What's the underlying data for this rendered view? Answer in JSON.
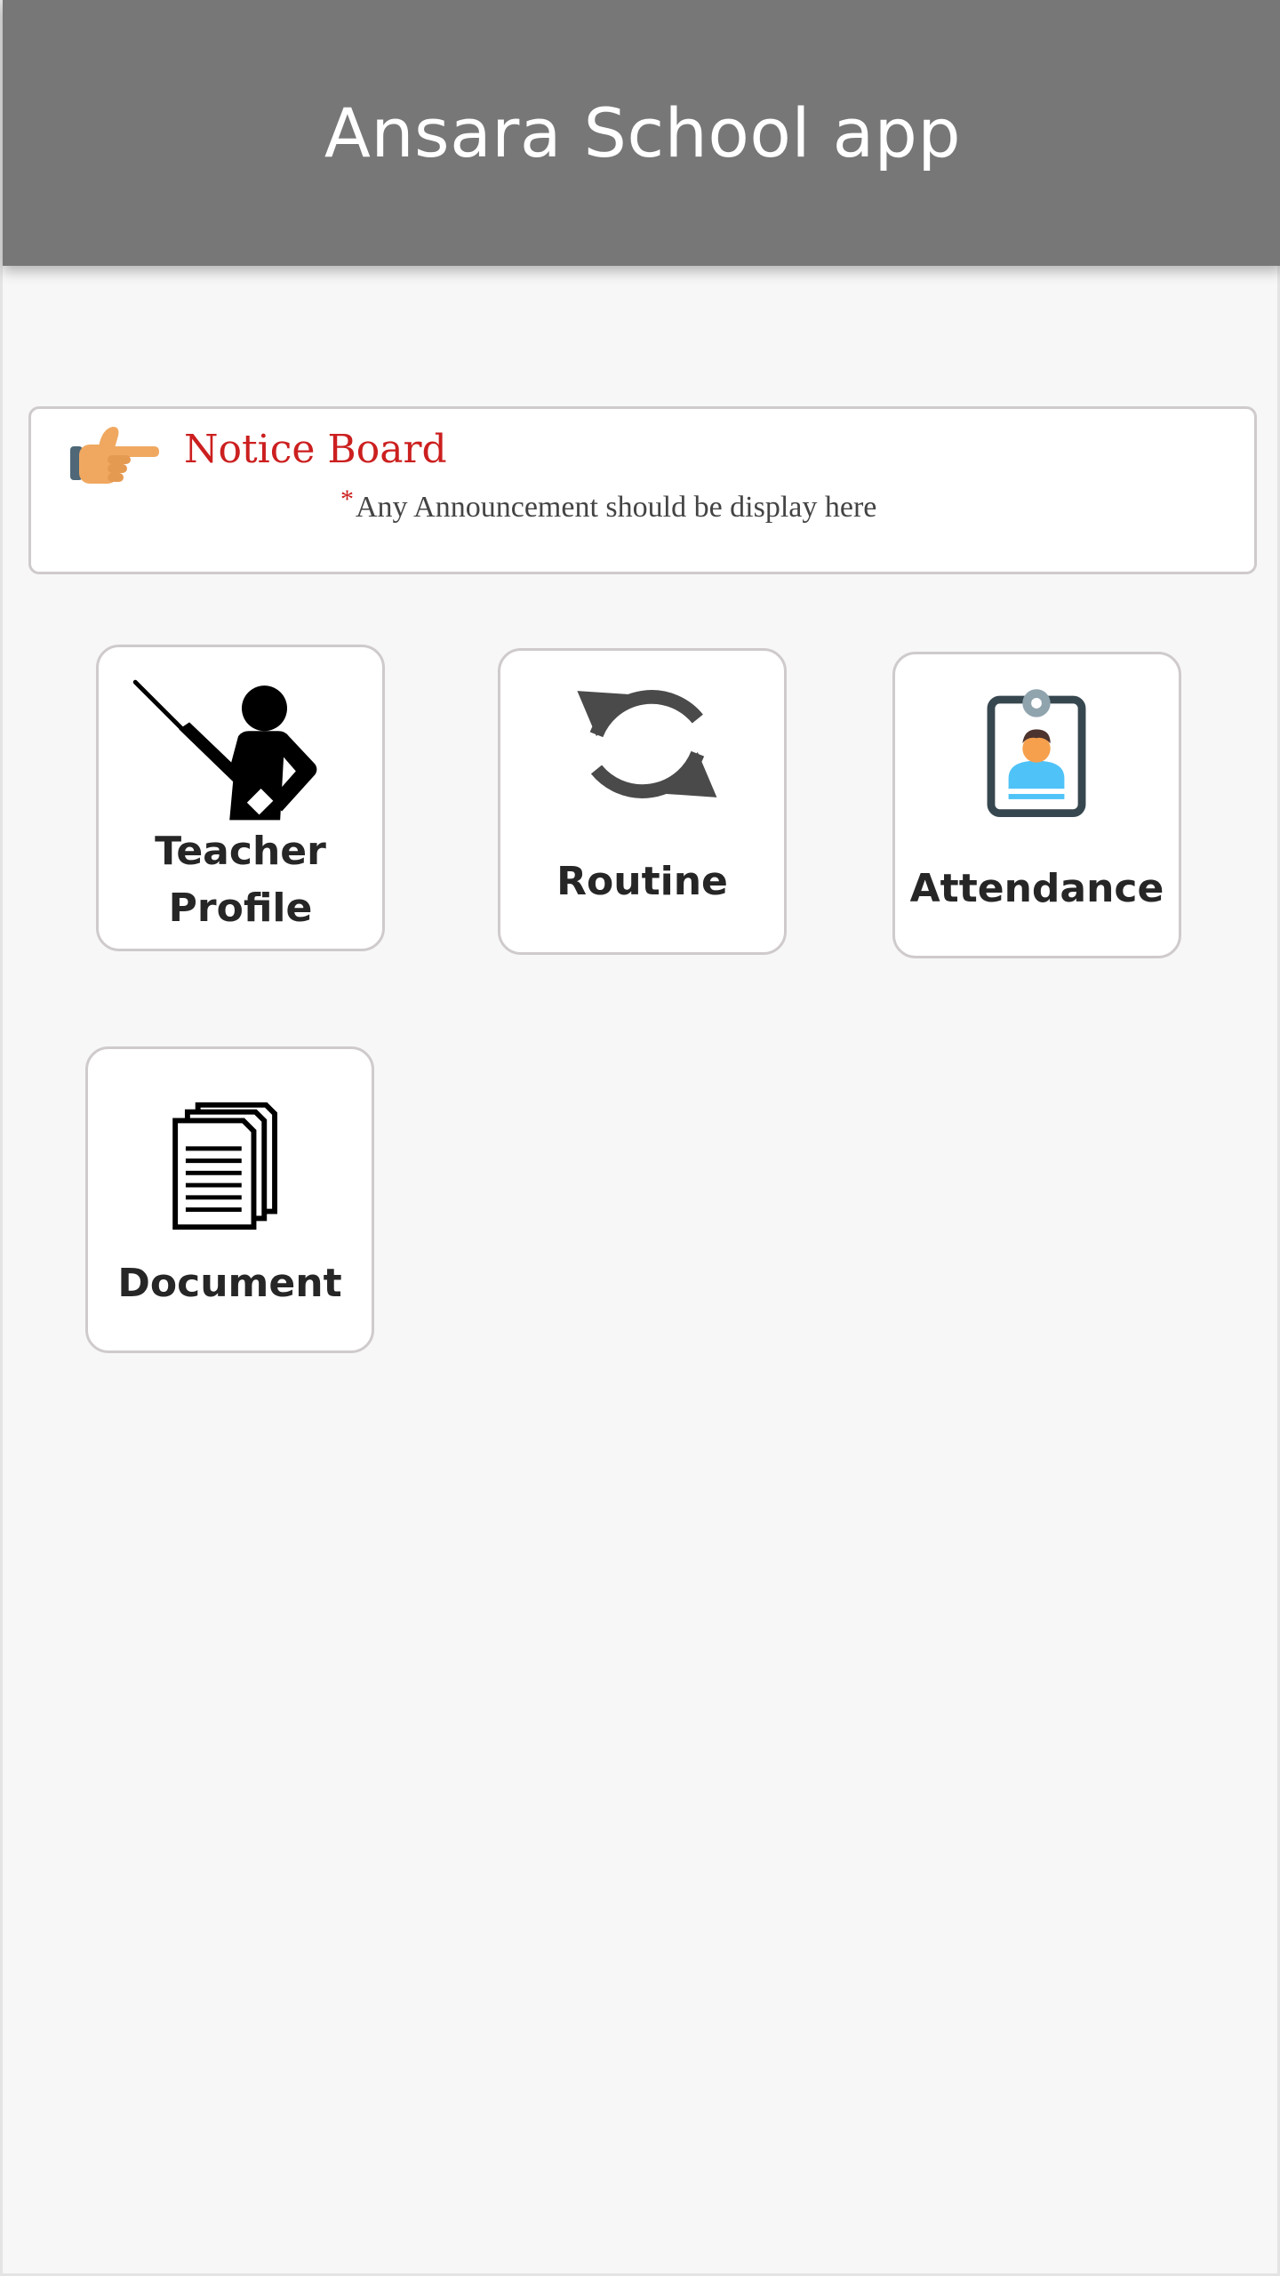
{
  "app_bar": {
    "title": "Ansara School app",
    "background_color": "#787778"
  },
  "notice_board": {
    "icon": "pointing-hand-icon",
    "title": "Notice Board",
    "required_marker": "*",
    "text": "Any Announcement should be display here",
    "title_color": "#cc1f1f"
  },
  "tiles": [
    {
      "label_line1": "Teacher",
      "label_line2": "Profile",
      "icon": "teacher-icon"
    },
    {
      "label": "Routine",
      "icon": "refresh-icon"
    },
    {
      "label": "Attendance",
      "icon": "id-badge-icon"
    },
    {
      "label": "Document",
      "icon": "documents-icon"
    }
  ]
}
